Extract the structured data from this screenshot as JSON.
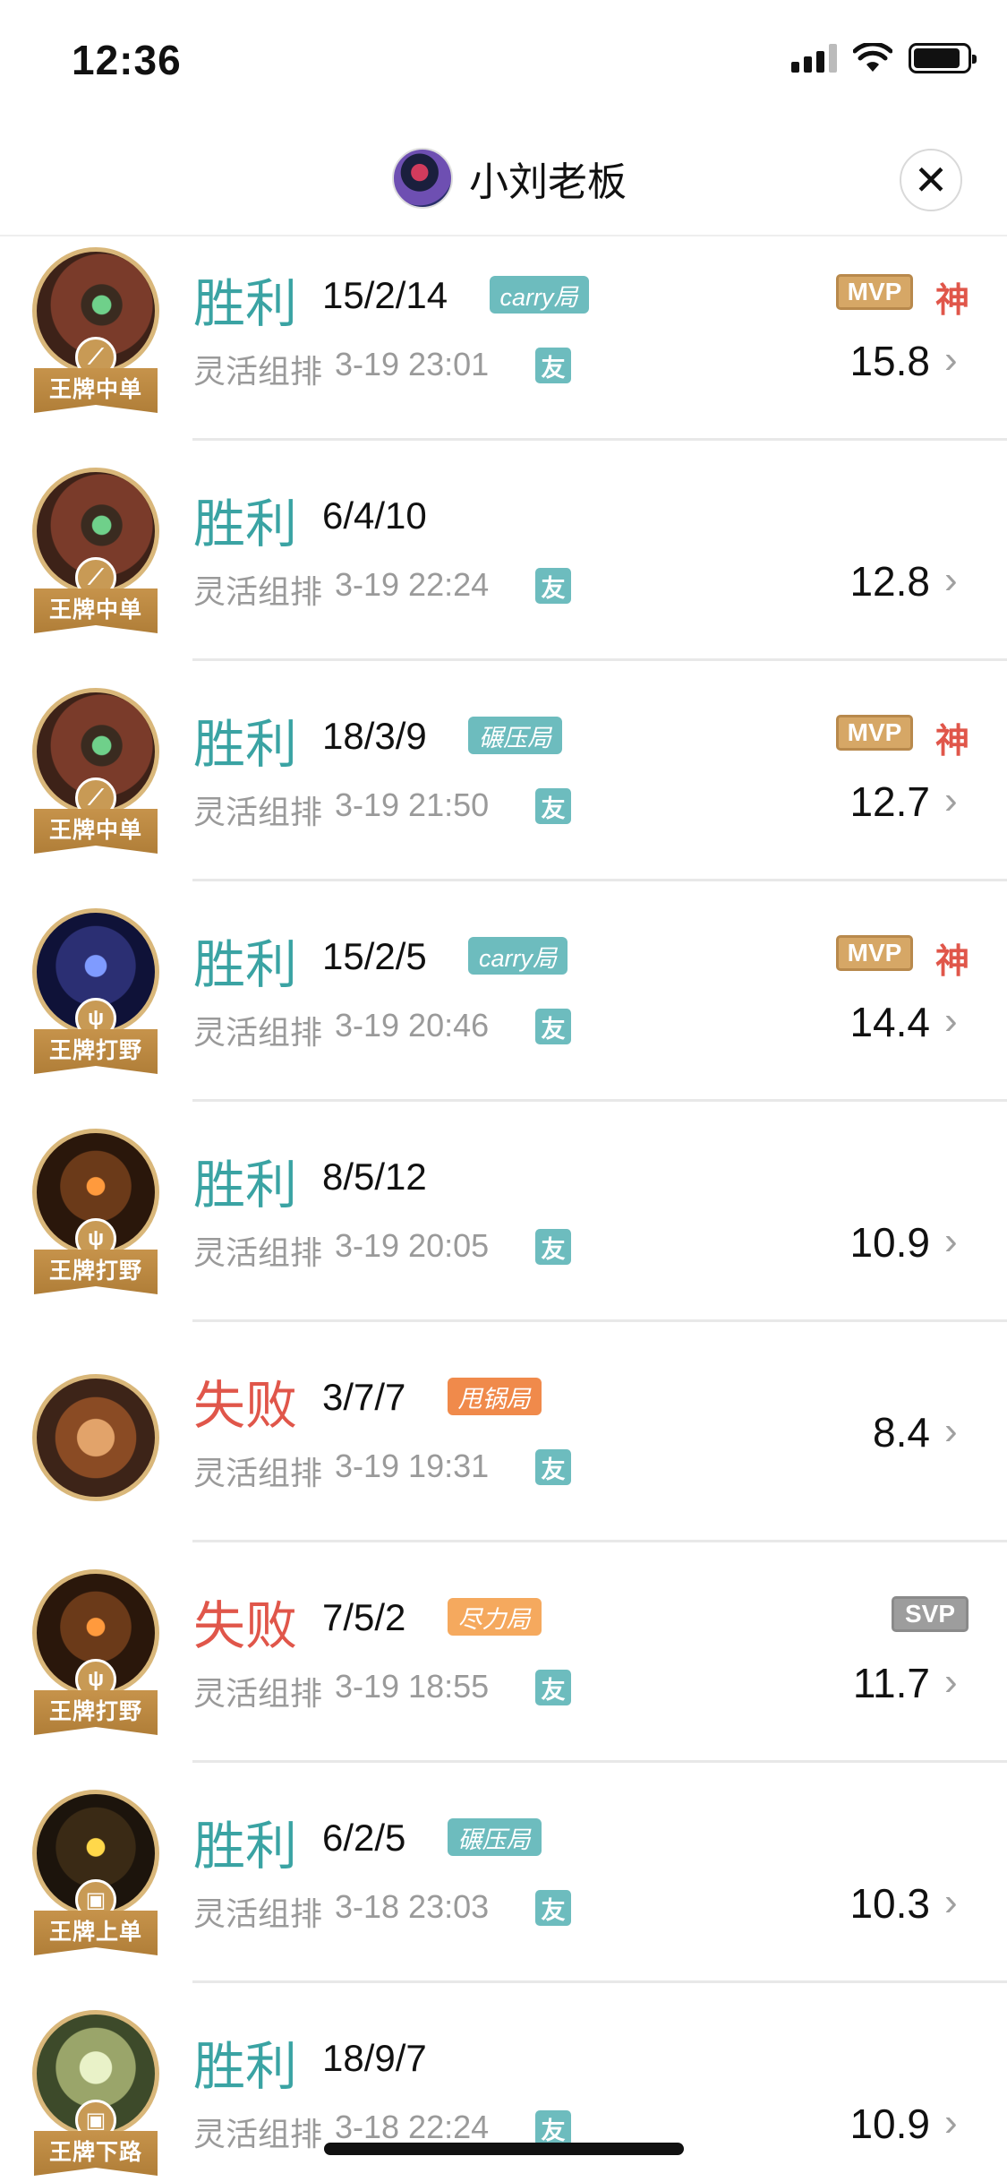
{
  "status_bar": {
    "time": "12:36",
    "signal_icon": "cellular-signal-icon",
    "wifi_icon": "wifi-icon",
    "battery_icon": "battery-icon"
  },
  "header": {
    "title": "小刘老板",
    "close_label": "✕"
  },
  "colors": {
    "win": "#3aa3a3",
    "loss": "#e0564a",
    "mvp": "#d6a766",
    "svp": "#9d9d9d",
    "badge": "#c6934b"
  },
  "matches": [
    {
      "result": "胜利",
      "kda": "15/2/14",
      "tag": "carry局",
      "mode": "灵活组排",
      "time": "3-19 23:01",
      "friend": "友",
      "medal": "MVP",
      "god": "神",
      "score": "15.8",
      "role": "王牌中单"
    },
    {
      "result": "胜利",
      "kda": "6/4/10",
      "tag": "",
      "mode": "灵活组排",
      "time": "3-19 22:24",
      "friend": "友",
      "medal": "",
      "god": "",
      "score": "12.8",
      "role": "王牌中单"
    },
    {
      "result": "胜利",
      "kda": "18/3/9",
      "tag": "碾压局",
      "mode": "灵活组排",
      "time": "3-19 21:50",
      "friend": "友",
      "medal": "MVP",
      "god": "神",
      "score": "12.7",
      "role": "王牌中单"
    },
    {
      "result": "胜利",
      "kda": "15/2/5",
      "tag": "carry局",
      "mode": "灵活组排",
      "time": "3-19 20:46",
      "friend": "友",
      "medal": "MVP",
      "god": "神",
      "score": "14.4",
      "role": "王牌打野"
    },
    {
      "result": "胜利",
      "kda": "8/5/12",
      "tag": "",
      "mode": "灵活组排",
      "time": "3-19 20:05",
      "friend": "友",
      "medal": "",
      "god": "",
      "score": "10.9",
      "role": "王牌打野"
    },
    {
      "result": "失败",
      "kda": "3/7/7",
      "tag": "甩锅局",
      "mode": "灵活组排",
      "time": "3-19 19:31",
      "friend": "友",
      "medal": "",
      "god": "",
      "score": "8.4",
      "role": ""
    },
    {
      "result": "失败",
      "kda": "7/5/2",
      "tag": "尽力局",
      "mode": "灵活组排",
      "time": "3-19 18:55",
      "friend": "友",
      "medal": "SVP",
      "god": "",
      "score": "11.7",
      "role": "王牌打野"
    },
    {
      "result": "胜利",
      "kda": "6/2/5",
      "tag": "碾压局",
      "mode": "灵活组排",
      "time": "3-18 23:03",
      "friend": "友",
      "medal": "",
      "god": "",
      "score": "10.3",
      "role": "王牌上单"
    },
    {
      "result": "胜利",
      "kda": "18/9/7",
      "tag": "",
      "mode": "灵活组排",
      "time": "3-18 22:24",
      "friend": "友",
      "medal": "",
      "god": "",
      "score": "10.9",
      "role": "王牌下路"
    }
  ]
}
